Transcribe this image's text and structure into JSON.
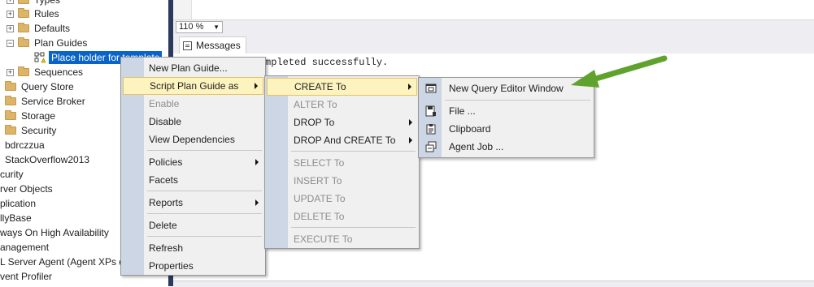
{
  "explorer": {
    "items": [
      {
        "label": "Types",
        "kind": "folder-expandable"
      },
      {
        "label": "Rules",
        "kind": "folder-expandable"
      },
      {
        "label": "Defaults",
        "kind": "folder-expandable"
      },
      {
        "label": "Plan Guides",
        "kind": "folder-expanded"
      },
      {
        "label": "Place holder for template",
        "kind": "plan-guide-selected"
      },
      {
        "label": "Sequences",
        "kind": "folder-expandable"
      },
      {
        "label": "Query Store",
        "kind": "folder"
      },
      {
        "label": "Service Broker",
        "kind": "folder"
      },
      {
        "label": "Storage",
        "kind": "folder"
      },
      {
        "label": "Security",
        "kind": "folder"
      },
      {
        "label": "bdrczzua",
        "kind": "text"
      },
      {
        "label": "StackOverflow2013",
        "kind": "text"
      },
      {
        "label": "curity",
        "kind": "text"
      },
      {
        "label": "rver Objects",
        "kind": "text"
      },
      {
        "label": "plication",
        "kind": "text"
      },
      {
        "label": "llyBase",
        "kind": "text"
      },
      {
        "label": "ways On High Availability",
        "kind": "text"
      },
      {
        "label": "anagement",
        "kind": "text"
      },
      {
        "label": "L Server Agent (Agent XPs d",
        "kind": "text"
      },
      {
        "label": "vent Profiler",
        "kind": "text"
      }
    ]
  },
  "zoom": {
    "value": "110 %"
  },
  "results": {
    "tab_label": "Messages",
    "message": "mpleted successfully."
  },
  "context_menu": {
    "new_plan_guide": "New Plan Guide...",
    "script_as": "Script Plan Guide as",
    "enable": "Enable",
    "disable": "Disable",
    "view_dependencies": "View Dependencies",
    "policies": "Policies",
    "facets": "Facets",
    "reports": "Reports",
    "delete": "Delete",
    "refresh": "Refresh",
    "properties": "Properties"
  },
  "script_submenu": {
    "create_to": "CREATE To",
    "alter_to": "ALTER To",
    "drop_to": "DROP To",
    "drop_create_to": "DROP And CREATE To",
    "select_to": "SELECT To",
    "insert_to": "INSERT To",
    "update_to": "UPDATE To",
    "delete_to": "DELETE To",
    "execute_to": "EXECUTE To"
  },
  "create_submenu": {
    "new_query_editor": "New Query Editor Window",
    "file": "File ...",
    "clipboard": "Clipboard",
    "agent_job": "Agent Job ..."
  },
  "colors": {
    "highlight_bg": "#fdf3bf",
    "highlight_border": "#e5c365",
    "selection_blue": "#0a64c8",
    "callout_green": "#5fa32e"
  }
}
